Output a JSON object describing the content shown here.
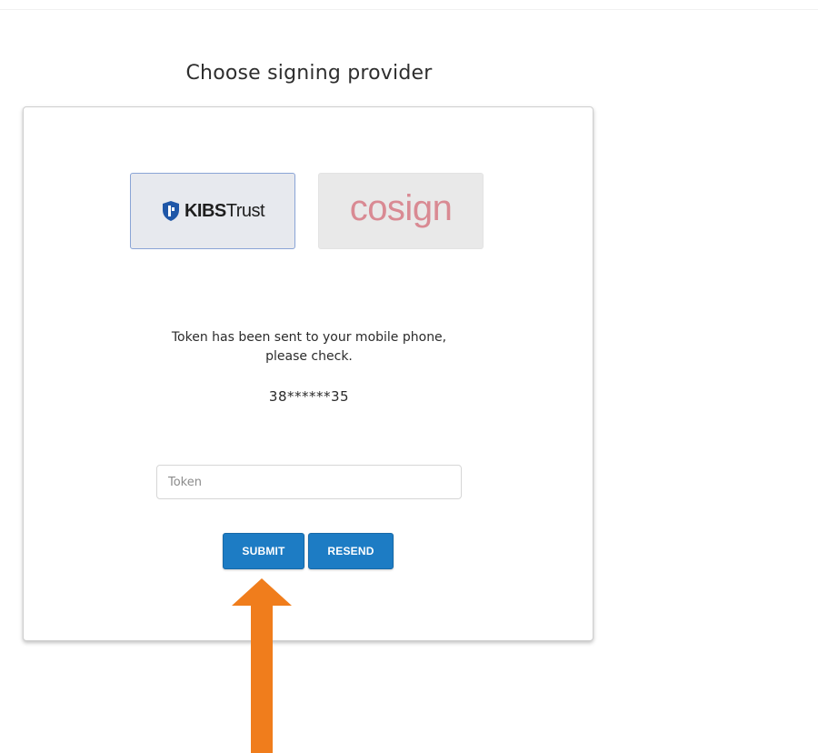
{
  "page": {
    "title": "Choose signing provider"
  },
  "providers": [
    {
      "id": "kibs",
      "label_bold": "KIBS",
      "label_regular": "Trust",
      "selected": true
    },
    {
      "id": "cosign",
      "label": "cosign",
      "selected": false
    }
  ],
  "message": {
    "text": "Token has been sent to your mobile phone, please check.",
    "phone_masked": "38******35"
  },
  "token": {
    "placeholder": "Token",
    "value": ""
  },
  "buttons": {
    "submit_label": "SUBMIT",
    "resend_label": "RESEND"
  },
  "colors": {
    "button_bg": "#1d7cc4",
    "arrow": "#f07d1c",
    "kibs_shield": "#1f57a8",
    "cosign_text": "#d98a93"
  },
  "annotation": {
    "icon": "arrow-up-icon"
  }
}
